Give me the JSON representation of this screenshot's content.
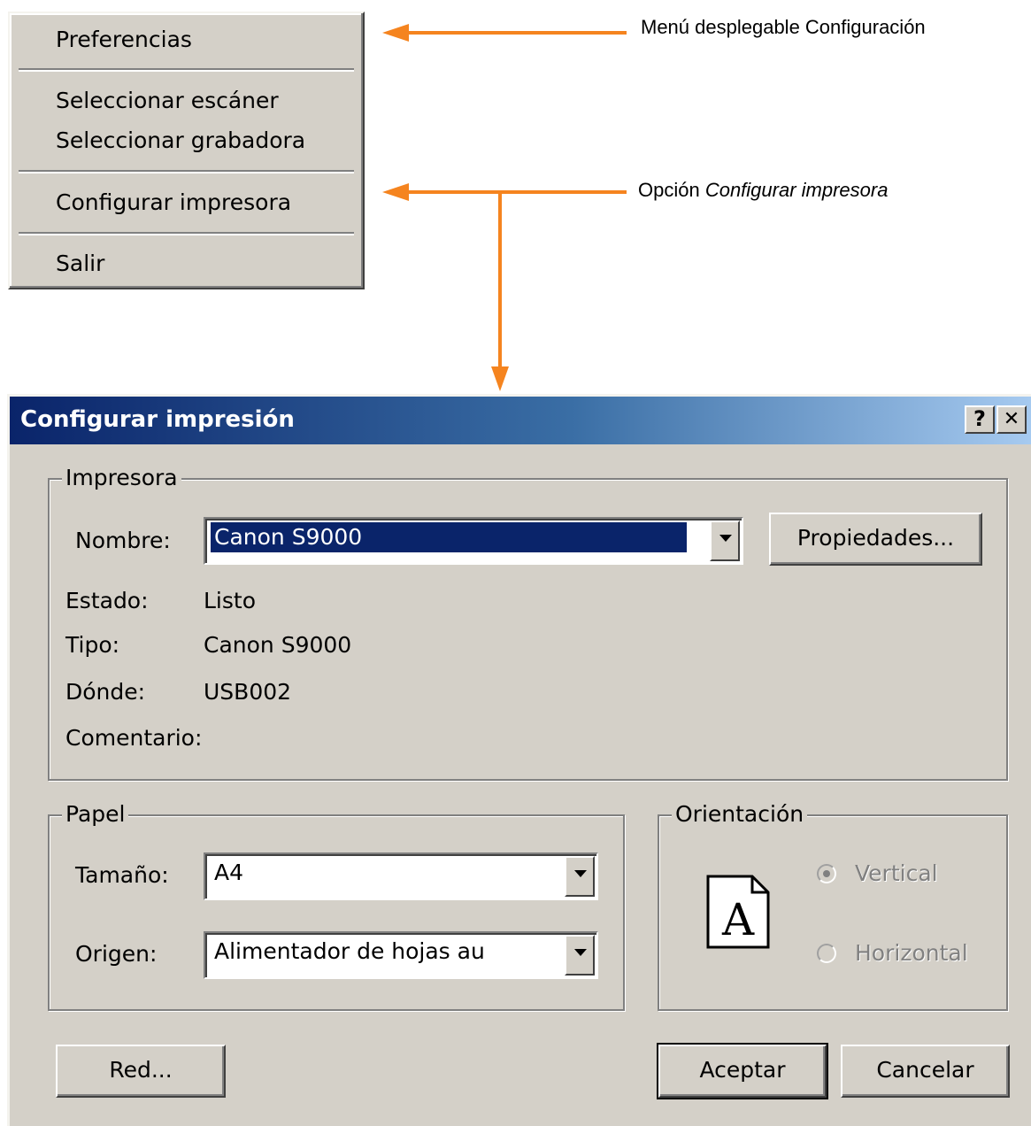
{
  "menu": {
    "items": [
      {
        "label": "Preferencias"
      },
      {
        "label": "Seleccionar escáner"
      },
      {
        "label": "Seleccionar grabadora"
      },
      {
        "label": "Configurar impresora"
      },
      {
        "label": "Salir"
      }
    ]
  },
  "callouts": {
    "menu_caption": "Menú desplegable Configuración",
    "option_prefix": "Opción ",
    "option_name": "Configurar impresora"
  },
  "dialog": {
    "title": "Configurar impresión",
    "help_glyph": "?",
    "close_glyph": "✕",
    "printer": {
      "group_label": "Impresora",
      "name_label": "Nombre:",
      "name_value": "Canon S9000",
      "properties_button": "Propiedades...",
      "status_label": "Estado:",
      "status_value": "Listo",
      "type_label": "Tipo:",
      "type_value": "Canon S9000",
      "where_label": "Dónde:",
      "where_value": "USB002",
      "comment_label": "Comentario:",
      "comment_value": ""
    },
    "paper": {
      "group_label": "Papel",
      "size_label": "Tamaño:",
      "size_value": "A4",
      "source_label": "Origen:",
      "source_value": "Alimentador de hojas au"
    },
    "orientation": {
      "group_label": "Orientación",
      "portrait_label": "Vertical",
      "landscape_label": "Horizontal",
      "selected": "Vertical",
      "page_glyph": "A"
    },
    "buttons": {
      "network": "Red...",
      "ok": "Aceptar",
      "cancel": "Cancelar"
    }
  },
  "colors": {
    "arrow": "#f5841f",
    "titlebar_start": "#0a246a",
    "titlebar_end": "#a6caf0",
    "face": "#d4d0c8"
  }
}
